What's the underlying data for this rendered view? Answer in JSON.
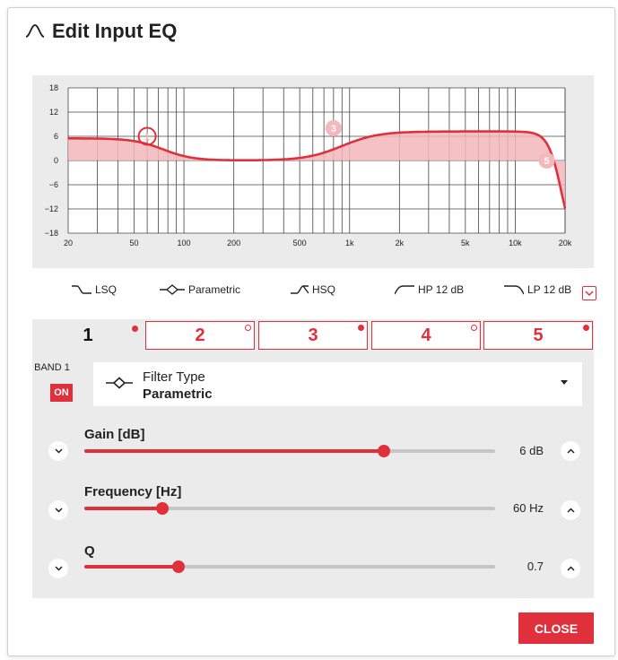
{
  "dialog": {
    "title": "Edit Input EQ",
    "close_label": "CLOSE"
  },
  "graph": {
    "y_ticks": [
      "18",
      "12",
      "6",
      "0",
      "−6",
      "−12",
      "−18"
    ],
    "x_ticks": [
      "20",
      "50",
      "100",
      "200",
      "500",
      "1k",
      "2k",
      "5k",
      "10k",
      "20k"
    ],
    "markers": [
      {
        "id": "1",
        "freq_hz": 60,
        "gain_db": 6,
        "selected": true
      },
      {
        "id": "3",
        "freq_hz": 800,
        "gain_db": 8,
        "selected": false
      },
      {
        "id": "5",
        "freq_hz": 15500,
        "gain_db": 0,
        "selected": false
      }
    ]
  },
  "filter_types": [
    {
      "label": "LSQ",
      "icon": "lsq-icon"
    },
    {
      "label": "Parametric",
      "icon": "parametric-icon"
    },
    {
      "label": "HSQ",
      "icon": "hsq-icon"
    },
    {
      "label": "HP 12 dB",
      "icon": "hp-icon"
    },
    {
      "label": "LP 12 dB",
      "icon": "lp-icon"
    }
  ],
  "bands": {
    "tabs": [
      {
        "label": "1",
        "active": true,
        "dot": "filled"
      },
      {
        "label": "2",
        "active": false,
        "dot": "hollow"
      },
      {
        "label": "3",
        "active": false,
        "dot": "filled"
      },
      {
        "label": "4",
        "active": false,
        "dot": "hollow"
      },
      {
        "label": "5",
        "active": false,
        "dot": "filled"
      }
    ],
    "band_label": "BAND 1",
    "on_label": "ON",
    "filter_type_label": "Filter Type",
    "filter_type_value": "Parametric"
  },
  "sliders": [
    {
      "label": "Gain [dB]",
      "value": "6 dB",
      "fraction": 0.73
    },
    {
      "label": "Frequency [Hz]",
      "value": "60 Hz",
      "fraction": 0.19
    },
    {
      "label": "Q",
      "value": "0.7",
      "fraction": 0.23
    }
  ],
  "colors": {
    "accent": "#e0303c",
    "curve_fill": "#f2b6ba",
    "panel_bg": "#ebebeb"
  }
}
